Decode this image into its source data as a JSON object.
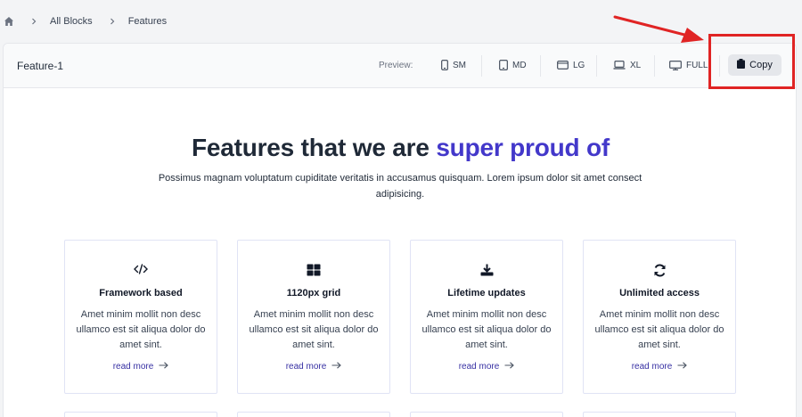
{
  "breadcrumb": {
    "items": [
      "All Blocks",
      "Features"
    ]
  },
  "toolbar": {
    "block_title": "Feature-1",
    "preview_label": "Preview:",
    "devices": [
      {
        "label": "SM",
        "icon": "phone-icon"
      },
      {
        "label": "MD",
        "icon": "tablet-icon"
      },
      {
        "label": "LG",
        "icon": "tablet-landscape-icon"
      },
      {
        "label": "XL",
        "icon": "laptop-icon"
      },
      {
        "label": "FULL",
        "icon": "desktop-icon"
      }
    ],
    "copy_label": "Copy"
  },
  "hero": {
    "title_main": "Features that we are",
    "title_accent": "super proud of",
    "subtitle": "Possimus magnam voluptatum cupiditate veritatis in accusamus quisquam. Lorem ipsum dolor sit amet consect adipisicing."
  },
  "cards": [
    {
      "icon": "code-icon",
      "title": "Framework based",
      "body": "Amet minim mollit non desc ullamco est sit aliqua dolor do amet sint.",
      "link": "read more"
    },
    {
      "icon": "grid-icon",
      "title": "1120px grid",
      "body": "Amet minim mollit non desc ullamco est sit aliqua dolor do amet sint.",
      "link": "read more"
    },
    {
      "icon": "download-icon",
      "title": "Lifetime updates",
      "body": "Amet minim mollit non desc ullamco est sit aliqua dolor do amet sint.",
      "link": "read more"
    },
    {
      "icon": "refresh-icon",
      "title": "Unlimited access",
      "body": "Amet minim mollit non desc ullamco est sit aliqua dolor do amet sint.",
      "link": "read more"
    }
  ],
  "colors": {
    "accent": "#4338ca",
    "annotation": "#e02424",
    "link": "#3730a3"
  }
}
